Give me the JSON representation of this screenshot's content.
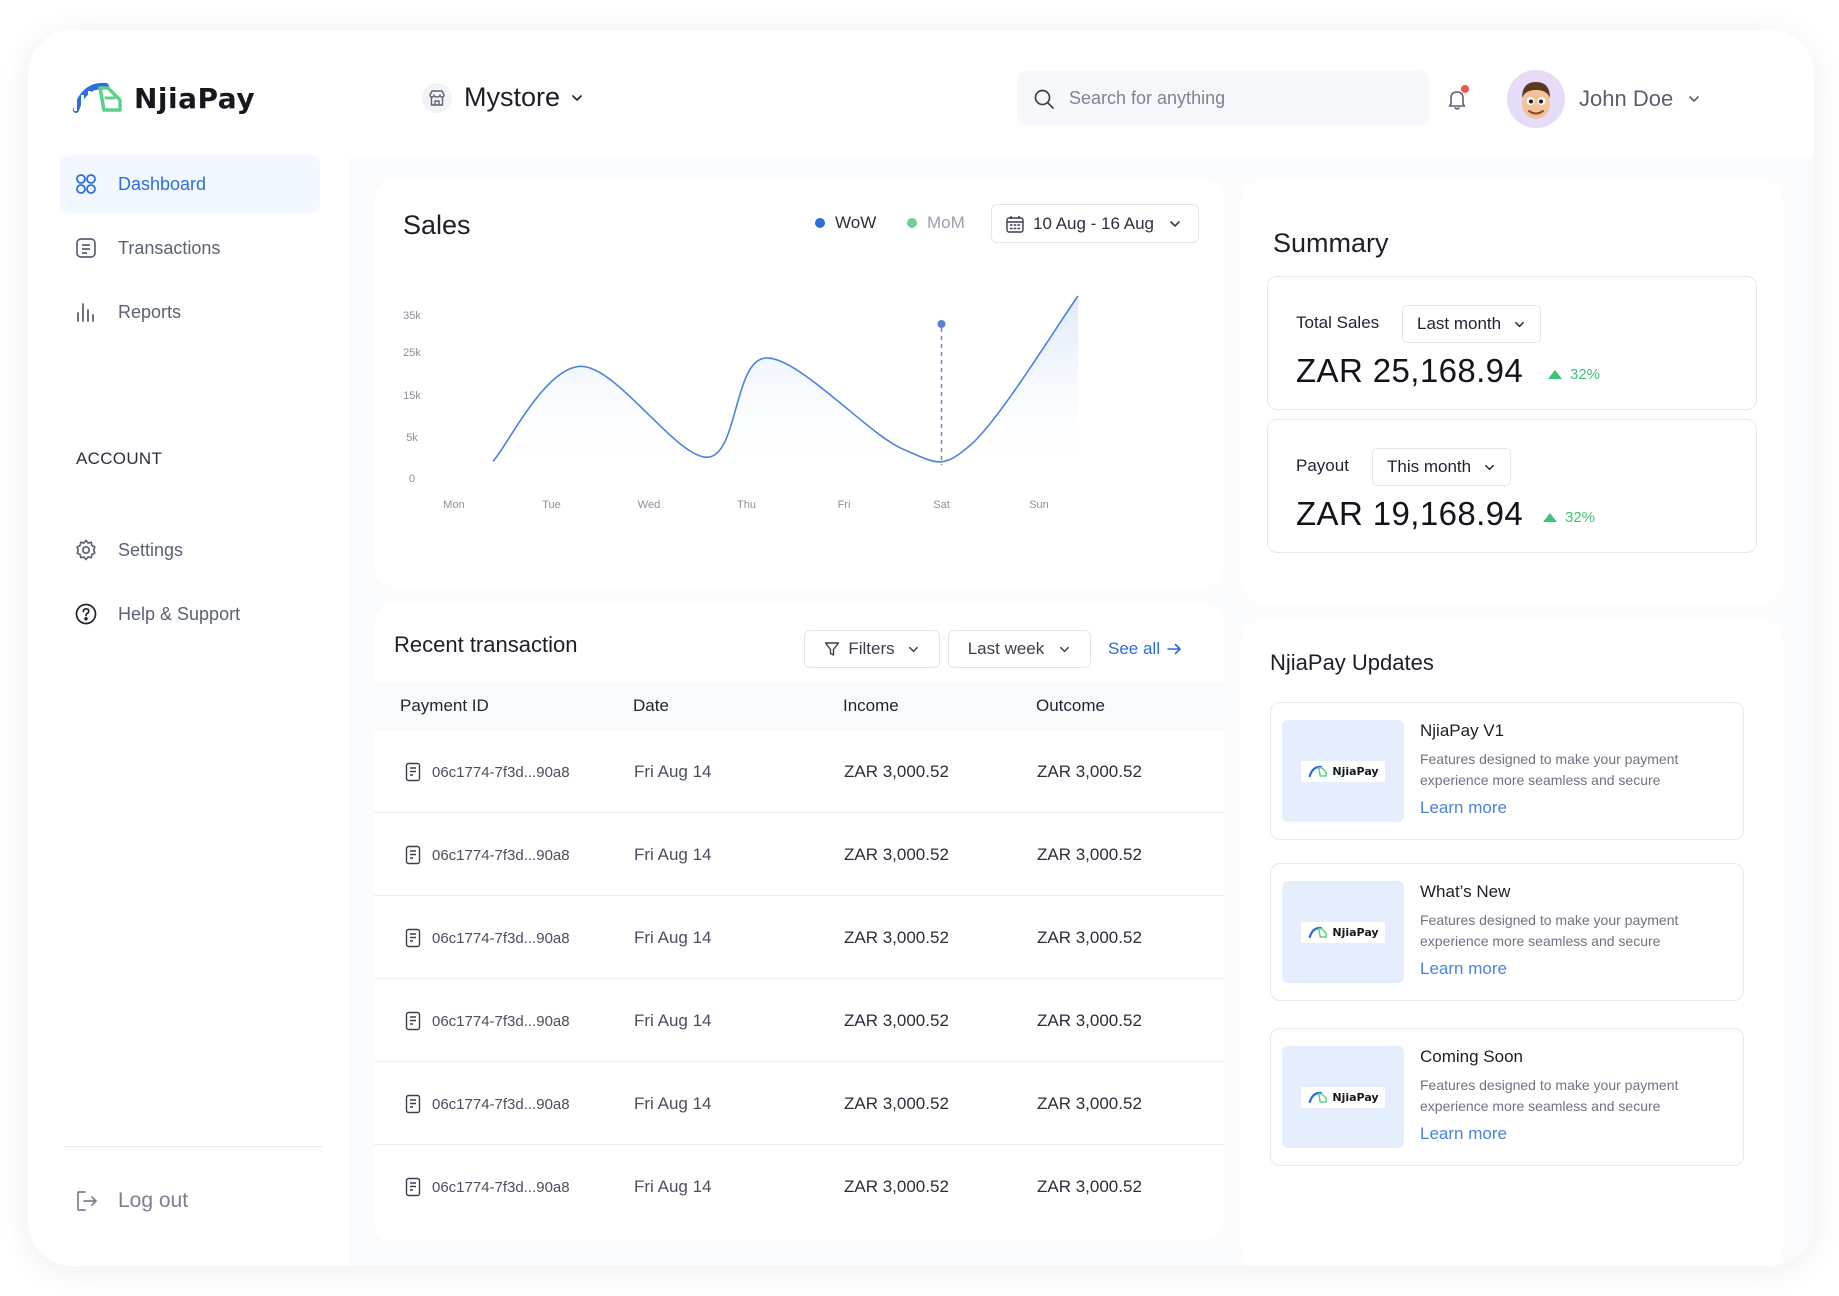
{
  "brand": {
    "name": "NjiaPay"
  },
  "sidebar": {
    "items": [
      {
        "label": "Dashboard",
        "icon": "dashboard-grid-icon",
        "active": true
      },
      {
        "label": "Transactions",
        "icon": "transactions-list-icon",
        "active": false
      },
      {
        "label": "Reports",
        "icon": "bar-chart-icon",
        "active": false
      }
    ],
    "account_section_label": "ACCOUNT",
    "account_items": [
      {
        "label": "Settings",
        "icon": "gear-icon"
      },
      {
        "label": "Help & Support",
        "icon": "help-circle-icon"
      }
    ],
    "logout_label": "Log out"
  },
  "header": {
    "store_name": "Mystore",
    "search_placeholder": "Search for anything",
    "user_name": "John Doe"
  },
  "sales": {
    "title": "Sales",
    "legend": [
      {
        "name": "WoW",
        "color": "#2a6fdb"
      },
      {
        "name": "MoM",
        "color": "#6fcf97"
      }
    ],
    "date_range": "10 Aug - 16 Aug",
    "chart_data": {
      "type": "area",
      "categories": [
        "Mon",
        "Tue",
        "Wed",
        "Thu",
        "Fri",
        "Sat",
        "Sun"
      ],
      "yticks": [
        "35k",
        "25k",
        "15k",
        "5k",
        "0"
      ],
      "series": [
        {
          "name": "WoW",
          "x": [
            0.4,
            1.3,
            2.6,
            3.2,
            4.6,
            5.3,
            6.4
          ],
          "y": [
            5,
            28,
            6,
            30,
            8,
            9,
            45
          ]
        }
      ],
      "highlight_category": "Sat",
      "grid": false
    }
  },
  "transactions": {
    "title": "Recent transaction",
    "filters_label": "Filters",
    "period_label": "Last week",
    "see_all_label": "See all",
    "columns": [
      "Payment ID",
      "Date",
      "Income",
      "Outcome"
    ],
    "rows": [
      {
        "id": "06c1774-7f3d...90a8",
        "date": "Fri Aug 14",
        "income": "ZAR 3,000.52",
        "outcome": "ZAR 3,000.52"
      },
      {
        "id": "06c1774-7f3d...90a8",
        "date": "Fri Aug 14",
        "income": "ZAR 3,000.52",
        "outcome": "ZAR 3,000.52"
      },
      {
        "id": "06c1774-7f3d...90a8",
        "date": "Fri Aug 14",
        "income": "ZAR 3,000.52",
        "outcome": "ZAR 3,000.52"
      },
      {
        "id": "06c1774-7f3d...90a8",
        "date": "Fri Aug 14",
        "income": "ZAR 3,000.52",
        "outcome": "ZAR 3,000.52"
      },
      {
        "id": "06c1774-7f3d...90a8",
        "date": "Fri Aug 14",
        "income": "ZAR 3,000.52",
        "outcome": "ZAR 3,000.52"
      },
      {
        "id": "06c1774-7f3d...90a8",
        "date": "Fri Aug 14",
        "income": "ZAR 3,000.52",
        "outcome": "ZAR 3,000.52"
      }
    ]
  },
  "summary": {
    "title": "Summary",
    "stats": [
      {
        "label": "Total Sales",
        "period": "Last month",
        "value": "ZAR 25,168.94",
        "change": "32%"
      },
      {
        "label": "Payout",
        "period": "This month",
        "value": "ZAR 19,168.94",
        "change": "32%"
      }
    ]
  },
  "updates": {
    "title": "NjiaPay Updates",
    "items": [
      {
        "title": "NjiaPay V1",
        "description": "Features designed to make your payment experience more seamless and secure",
        "link": "Learn more"
      },
      {
        "title": "What’s New",
        "description": "Features designed to make your payment experience more seamless and secure",
        "link": "Learn more"
      },
      {
        "title": "Coming Soon",
        "description": "Features designed to make your payment experience more seamless and secure",
        "link": "Learn more"
      }
    ]
  }
}
